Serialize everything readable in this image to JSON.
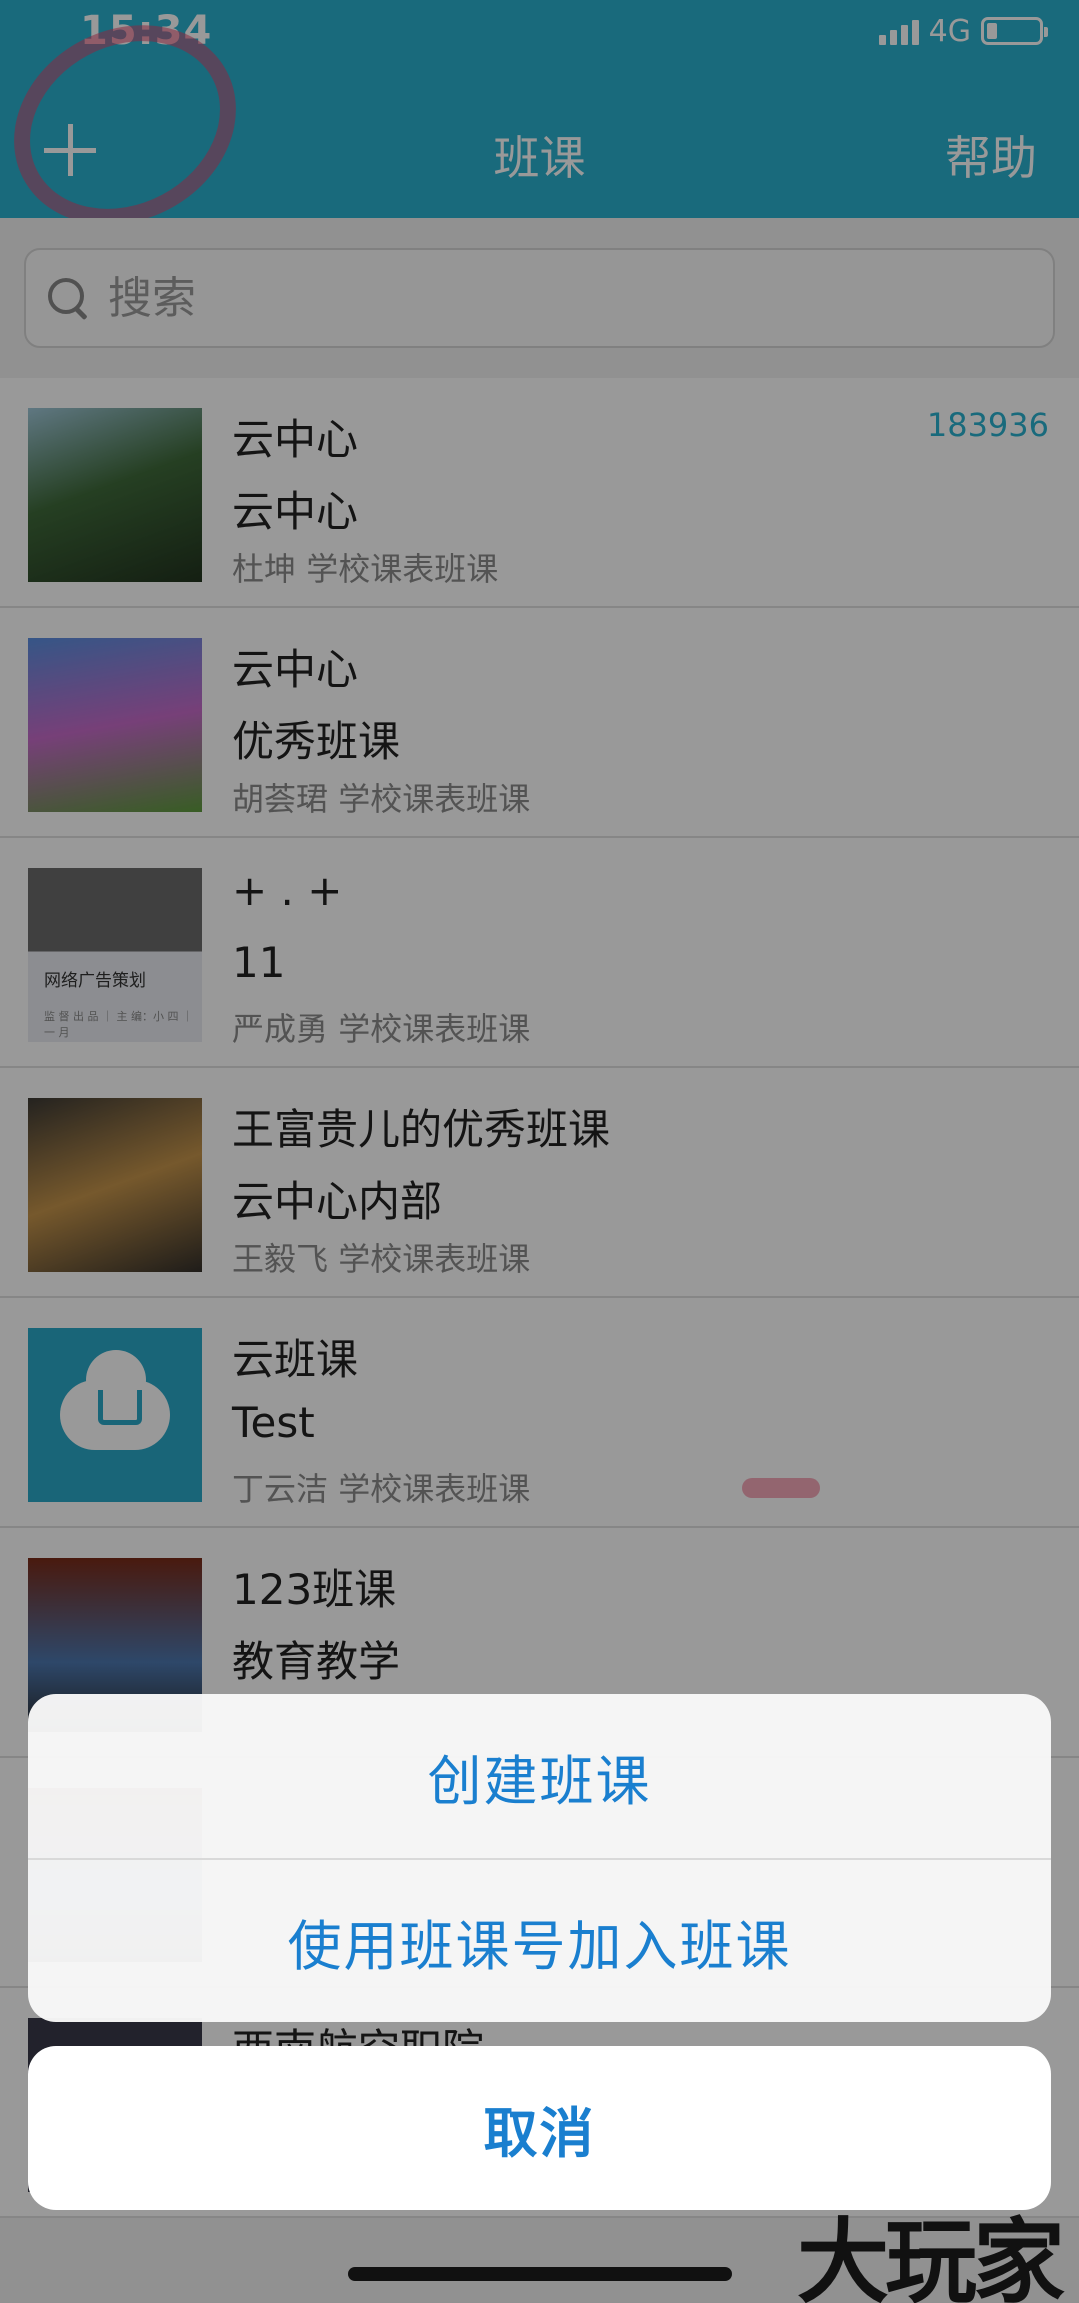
{
  "status_bar": {
    "time": "15:34",
    "network": "4G"
  },
  "header": {
    "add_label": "",
    "title": "班课",
    "help_label": "帮助"
  },
  "search": {
    "placeholder": "搜索"
  },
  "courses": [
    {
      "title": "云中心",
      "subtitle": "云中心",
      "teacher": "杜坤",
      "type": "学校课表班课",
      "code": "183936"
    },
    {
      "title": "云中心",
      "subtitle": "优秀班课",
      "teacher": "胡荟珺",
      "type": "学校课表班课"
    },
    {
      "title": "+ . +",
      "subtitle": "11",
      "teacher": "严成勇",
      "type": "学校课表班课",
      "thumb_text": "网络广告策划",
      "thumb_small_text": "监 督 出 品 ｜ 主 编：小 四 ｜ 一 月"
    },
    {
      "title": "王富贵儿的优秀班课",
      "subtitle": "云中心内部",
      "teacher": "王毅飞",
      "type": "学校课表班课"
    },
    {
      "title": "云班课",
      "subtitle": "Test",
      "teacher": "丁云洁",
      "type": "学校课表班课"
    },
    {
      "title": "123班课",
      "subtitle": "教育教学"
    },
    {
      "title": "西南航空职院"
    }
  ],
  "action_sheet": {
    "create_label": "创建班课",
    "join_label": "使用班课号加入班课",
    "cancel_label": "取消"
  },
  "watermark": "大玩家"
}
